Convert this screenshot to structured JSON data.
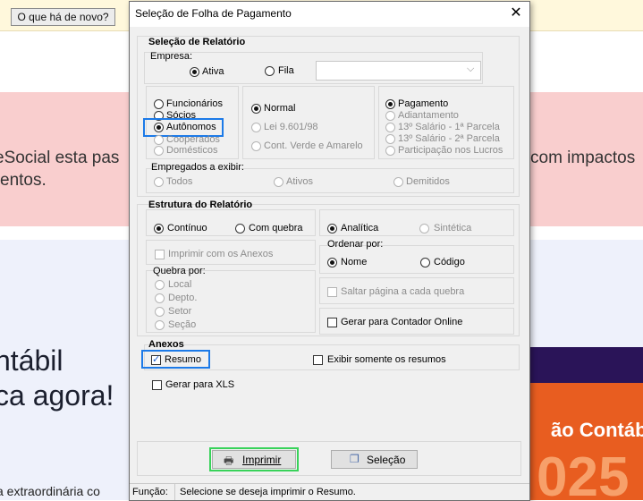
{
  "background": {
    "news_button": "O que há de novo?",
    "band_left_1": "eSocial esta pas",
    "band_left_2": "entos.",
    "band_right_1": "com impactos",
    "big_left_1": "ntábil",
    "big_left_2": "ca agora!",
    "bottom_text": "a extraordinária co",
    "promo_word": "ão Contábil",
    "promo_number": "025"
  },
  "dialog": {
    "title": "Seleção de Folha de Pagamento",
    "close_glyph": "✕",
    "relatorio": {
      "title": "Seleção de Relatório",
      "empresa_label": "Empresa:",
      "empresa_ativa": "Ativa",
      "empresa_fila": "Fila",
      "combo_value": "",
      "tipo_options": [
        "Funcionários",
        "Sócios",
        "Autônomos",
        "Cooperados",
        "Domésticos"
      ],
      "regime_options": [
        "Normal",
        "Lei 9.601/98",
        "Cont. Verde e Amarelo"
      ],
      "pagamento_options": [
        "Pagamento",
        "Adiantamento",
        "13º Salário  -  1ª Parcela",
        "13º Salário  -  2ª Parcela",
        "Participação nos Lucros"
      ],
      "empregados_label": "Empregados a exibir:",
      "empregados_options": [
        "Todos",
        "Ativos",
        "Demitidos"
      ]
    },
    "estrutura": {
      "title": "Estrutura do Relatório",
      "continuo": "Contínuo",
      "com_quebra": "Com quebra",
      "analitica": "Analítica",
      "sintetica": "Sintética",
      "imprimir_anexos": "Imprimir com os Anexos",
      "ordenar_label": "Ordenar por:",
      "ordenar_nome": "Nome",
      "ordenar_codigo": "Código",
      "quebra_label": "Quebra por:",
      "quebra_options": [
        "Local",
        "Depto.",
        "Setor",
        "Seção"
      ],
      "saltar": "Saltar página a cada quebra",
      "gerar_contador": "Gerar para Contador Online"
    },
    "anexos": {
      "title": "Anexos",
      "resumo": "Resumo",
      "exibir_resumos": "Exibir somente os resumos"
    },
    "gerar_xls": "Gerar para XLS",
    "buttons": {
      "imprimir": "Imprimir",
      "selecao": "Seleção"
    },
    "status": {
      "label": "Função:",
      "text": "Selecione se deseja imprimir o Resumo."
    }
  }
}
